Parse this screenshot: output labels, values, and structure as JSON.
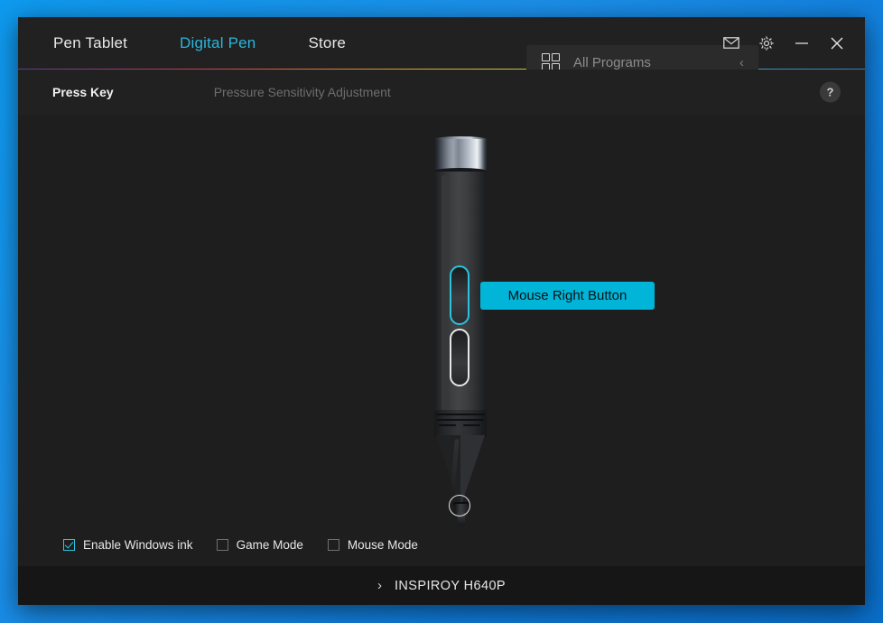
{
  "window": {
    "tabs": [
      {
        "label": "Pen Tablet",
        "active": false
      },
      {
        "label": "Digital Pen",
        "active": true
      },
      {
        "label": "Store",
        "active": false
      }
    ],
    "all_programs": {
      "label": "All Programs",
      "grid_icon": "grid-icon",
      "chevron_icon": "chevron-left-icon"
    },
    "controls": {
      "mail_icon": "mail-icon",
      "settings_icon": "gear-icon",
      "minimize_icon": "minimize-icon",
      "close_icon": "close-icon"
    }
  },
  "subnav": {
    "press_key": "Press Key",
    "pressure_sensitivity": "Pressure Sensitivity Adjustment",
    "help": "?"
  },
  "pen": {
    "upper_button_callout": "Mouse Right Button",
    "upper_button_name": "pen-upper-button",
    "lower_button_name": "pen-lower-button",
    "nib_indicator_name": "pen-nib-indicator"
  },
  "options": [
    {
      "label": "Enable Windows ink",
      "checked": true
    },
    {
      "label": "Game Mode",
      "checked": false
    },
    {
      "label": "Mouse Mode",
      "checked": false
    }
  ],
  "device_bar": {
    "chevron": "›",
    "name": "INSPIROY H640P"
  },
  "colors": {
    "accent_cyan": "#29b6dd",
    "callout_bg": "#00b5d8",
    "window_bg": "#1e1e1e",
    "titlebar_bg": "#212121",
    "device_bar_bg": "#161616",
    "desktop_blue": "#0f86e4"
  }
}
